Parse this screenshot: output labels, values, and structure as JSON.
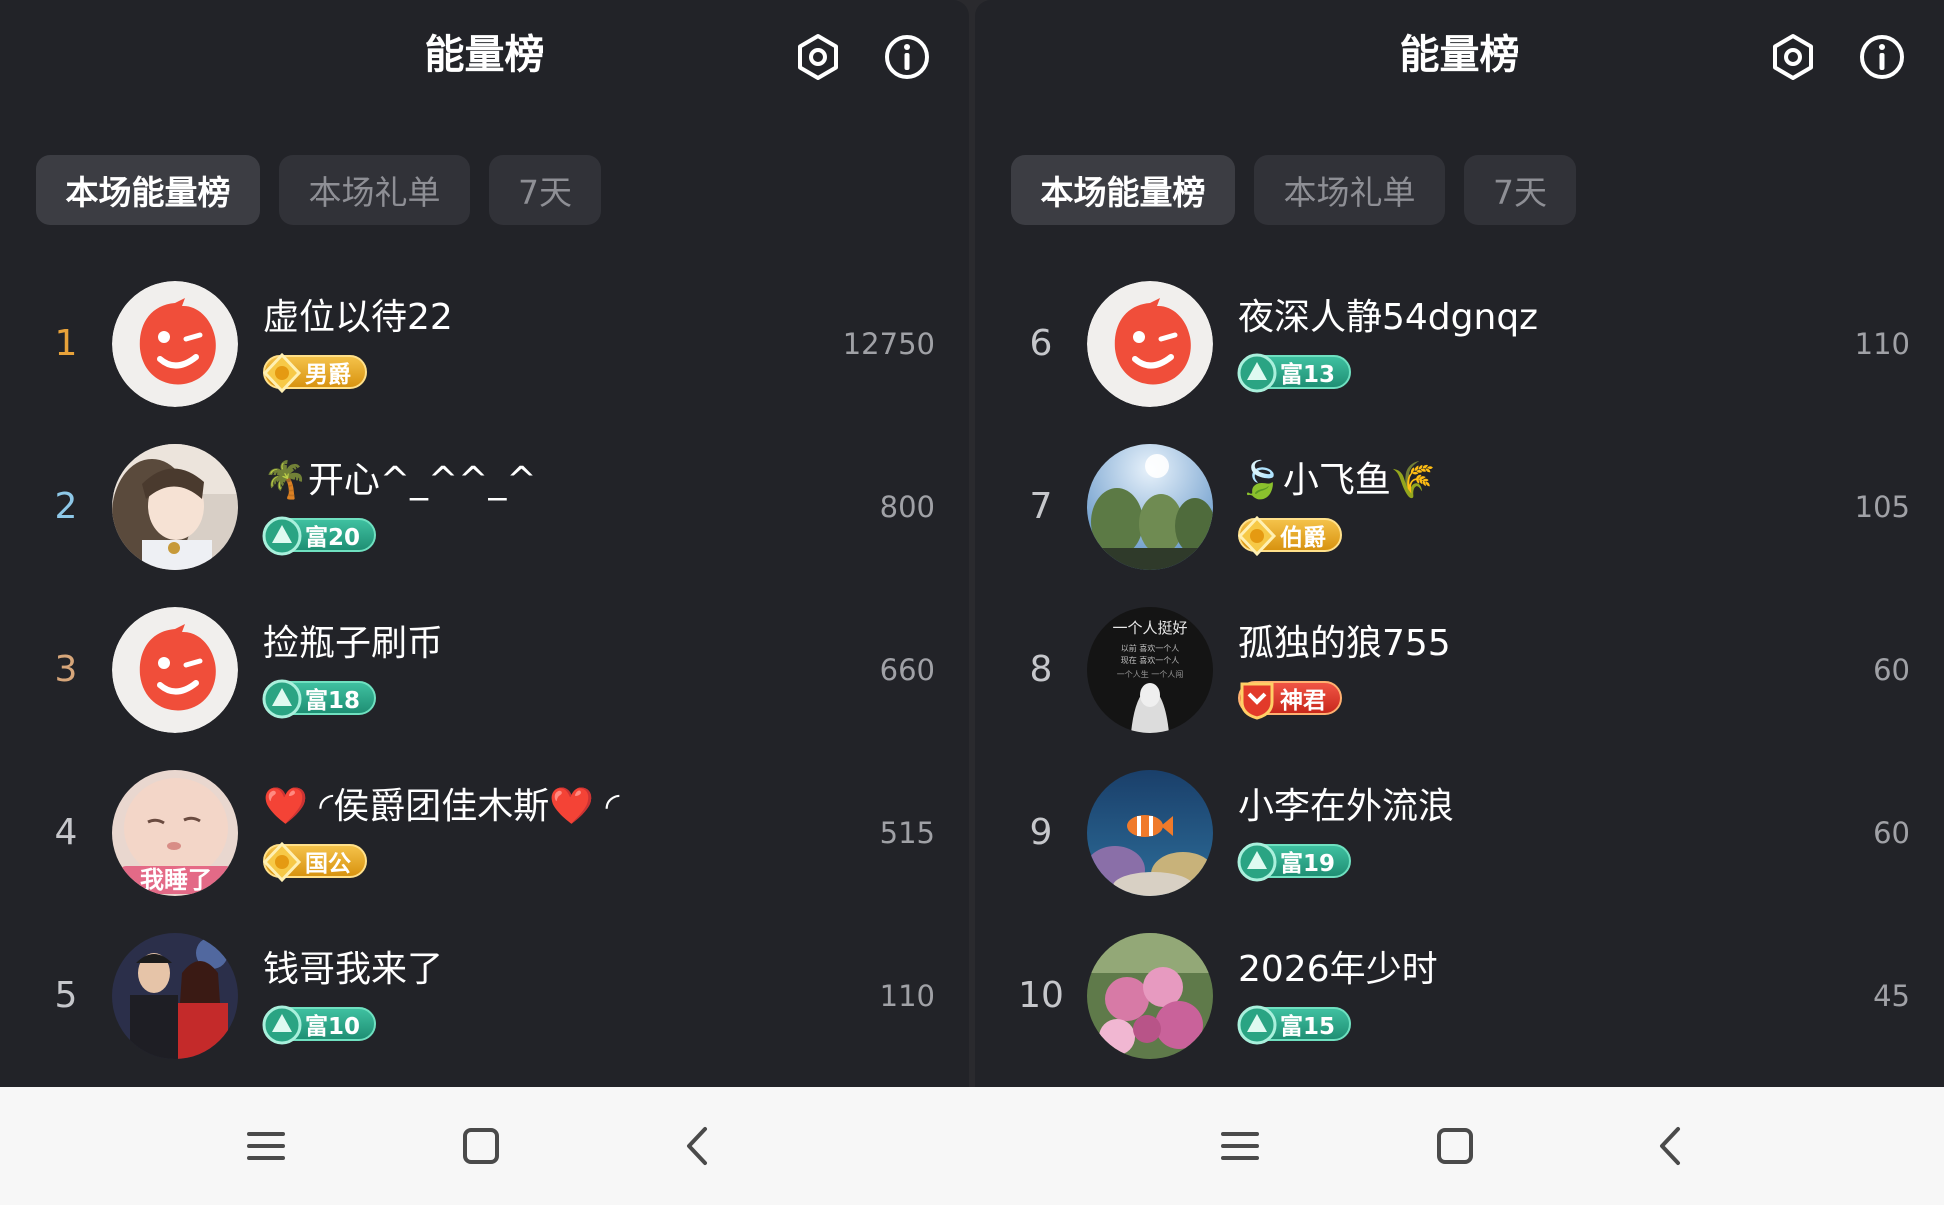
{
  "panels": [
    {
      "title": "能量榜",
      "tabs": [
        {
          "label": "本场能量榜",
          "active": true
        },
        {
          "label": "本场礼单",
          "active": false
        },
        {
          "label": "7天",
          "active": false
        }
      ],
      "rows": [
        {
          "rank": "1",
          "rank_color": "#e8a23a",
          "name": "虚位以待22",
          "badge": "男爵",
          "badge_type": "jue",
          "score": "12750",
          "avatar": "default-red-avatar"
        },
        {
          "rank": "2",
          "rank_color": "#8ec8e8",
          "name": "🌴开心^_^^_^",
          "badge": "富20",
          "badge_type": "fu",
          "score": "800",
          "avatar": "girl-photo-avatar"
        },
        {
          "rank": "3",
          "rank_color": "#d7a67a",
          "name": "捡瓶子刷币",
          "badge": "富18",
          "badge_type": "fu",
          "score": "660",
          "avatar": "default-red-avatar"
        },
        {
          "rank": "4",
          "rank_color": "#c6c7cb",
          "name": "❤️ ◜侯爵团佳木斯❤️ ◜",
          "badge": "国公",
          "badge_type": "jue",
          "score": "515",
          "avatar": "baby-photo-avatar"
        },
        {
          "rank": "5",
          "rank_color": "#c6c7cb",
          "name": "钱哥我来了",
          "badge": "富10",
          "badge_type": "fu",
          "score": "110",
          "avatar": "singers-photo-avatar"
        }
      ]
    },
    {
      "title": "能量榜",
      "tabs": [
        {
          "label": "本场能量榜",
          "active": true
        },
        {
          "label": "本场礼单",
          "active": false
        },
        {
          "label": "7天",
          "active": false
        }
      ],
      "rows": [
        {
          "rank": "6",
          "rank_color": "#c6c7cb",
          "name": "夜深人静54dgnqz",
          "badge": "富13",
          "badge_type": "fu",
          "score": "110",
          "avatar": "default-red-avatar"
        },
        {
          "rank": "7",
          "rank_color": "#c6c7cb",
          "name": "🍃小飞鱼🌾",
          "badge": "伯爵",
          "badge_type": "jue",
          "score": "105",
          "avatar": "trees-photo-avatar"
        },
        {
          "rank": "8",
          "rank_color": "#c6c7cb",
          "name": "孤独的狼755",
          "badge": "神君",
          "badge_type": "shen",
          "score": "60",
          "avatar": "text-poster-avatar"
        },
        {
          "rank": "9",
          "rank_color": "#c6c7cb",
          "name": "小李在外流浪",
          "badge": "富19",
          "badge_type": "fu",
          "score": "60",
          "avatar": "aquarium-photo-avatar"
        },
        {
          "rank": "10",
          "rank_color": "#c6c7cb",
          "name": "2026年少时",
          "badge": "富15",
          "badge_type": "fu",
          "score": "45",
          "avatar": "flowers-photo-avatar"
        }
      ]
    }
  ],
  "icons": {
    "settings": "hexagon-settings-icon",
    "info": "info-icon"
  },
  "navbar": [
    "menu-icon",
    "home-icon",
    "back-icon"
  ]
}
